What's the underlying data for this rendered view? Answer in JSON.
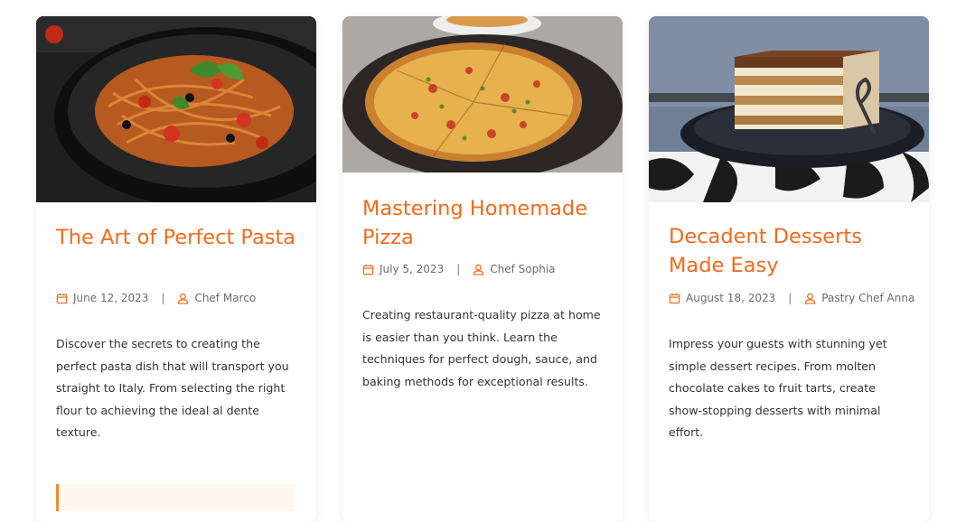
{
  "posts": [
    {
      "title": "The Art of Perfect Pasta",
      "date": "June 12, 2023",
      "author": "Chef Marco",
      "excerpt": "Discover the secrets to creating the perfect pasta dish that will transport you straight to Italy. From selecting the right flour to achieving the ideal al dente texture."
    },
    {
      "title": "Mastering Homemade Pizza",
      "date": "July 5, 2023",
      "author": "Chef Sophia",
      "excerpt": "Creating restaurant-quality pizza at home is easier than you think. Learn the techniques for perfect dough, sauce, and baking methods for exceptional results."
    },
    {
      "title": "Decadent Desserts Made Easy",
      "date": "August 18, 2023",
      "author": "Pastry Chef Anna",
      "excerpt": "Impress your guests with stunning yet simple dessert recipes. From molten chocolate cakes to fruit tarts, create show-stopping desserts with minimal effort."
    }
  ],
  "meta": {
    "separator": "|"
  },
  "icons": {
    "date": "calendar-icon",
    "author": "user-icon"
  },
  "colors": {
    "accent": "#f26a1b",
    "text": "#333333",
    "muted": "#6b6b6b",
    "quote_bar": "#f28c28"
  }
}
